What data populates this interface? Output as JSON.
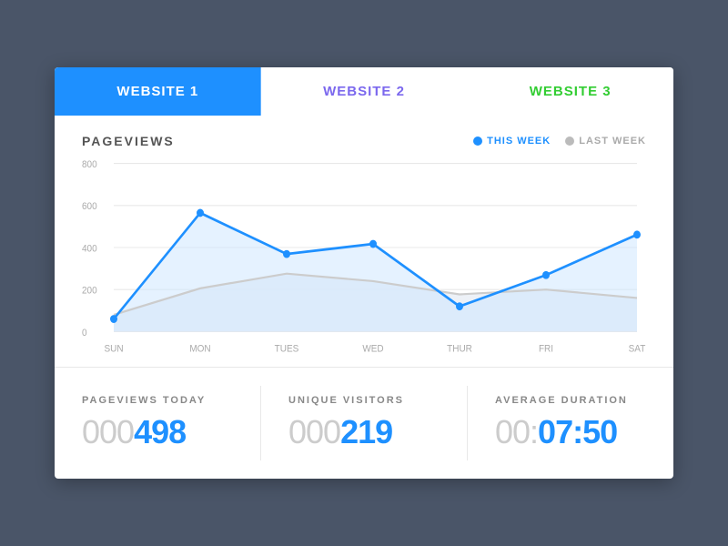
{
  "tabs": [
    {
      "label": "WEBSITE 1",
      "active": true,
      "color": "blue"
    },
    {
      "label": "WEBSITE 2",
      "active": false,
      "color": "purple"
    },
    {
      "label": "WEBSITE 3",
      "active": false,
      "color": "green"
    }
  ],
  "chart": {
    "title": "PAGEVIEWS",
    "legend": {
      "this_week": "THIS WEEK",
      "last_week": "LAST WEEK"
    },
    "y_axis": [
      800,
      600,
      400,
      200,
      0
    ],
    "x_axis": [
      "SUN",
      "MON",
      "TUES",
      "WED",
      "THUR",
      "FRI",
      "SAT"
    ],
    "this_week_data": [
      60,
      565,
      370,
      420,
      120,
      270,
      460
    ],
    "last_week_data": [
      80,
      210,
      280,
      240,
      180,
      200,
      160
    ]
  },
  "stats": [
    {
      "label": "PAGEVIEWS TODAY",
      "prefix": "000",
      "value": "498"
    },
    {
      "label": "UNIQUE VISITORS",
      "prefix": "000",
      "value": "219"
    },
    {
      "label": "AVERAGE DURATION",
      "prefix": "00:",
      "value": "07:50"
    }
  ]
}
